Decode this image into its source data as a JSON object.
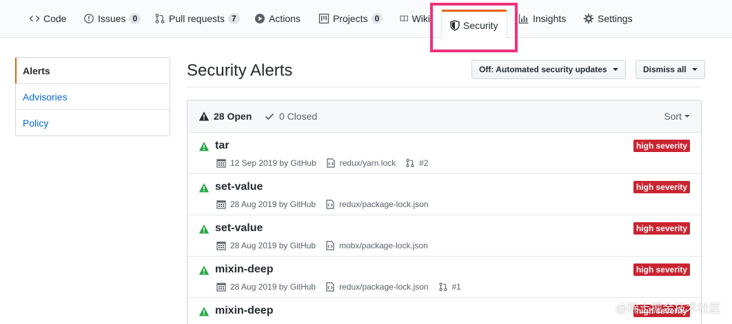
{
  "tabs": [
    {
      "label": "Code",
      "icon": "code-icon"
    },
    {
      "label": "Issues",
      "count": "0",
      "icon": "issue-icon"
    },
    {
      "label": "Pull requests",
      "count": "7",
      "icon": "pull-request-icon"
    },
    {
      "label": "Actions",
      "icon": "play-icon"
    },
    {
      "label": "Projects",
      "count": "0",
      "icon": "project-icon"
    },
    {
      "label": "Wiki",
      "icon": "book-icon"
    },
    {
      "label": "Security",
      "icon": "shield-icon",
      "selected": true
    },
    {
      "label": "Insights",
      "icon": "graph-icon"
    },
    {
      "label": "Settings",
      "icon": "gear-icon"
    }
  ],
  "menu": {
    "items": [
      {
        "label": "Alerts",
        "selected": true
      },
      {
        "label": "Advisories"
      },
      {
        "label": "Policy"
      }
    ]
  },
  "main": {
    "title": "Security Alerts",
    "auto_updates_button": "Off: Automated security updates",
    "dismiss_button": "Dismiss all"
  },
  "alerts_header": {
    "open": "28 Open",
    "closed": "0 Closed",
    "sort": "Sort"
  },
  "alerts": [
    {
      "name": "tar",
      "date": "12 Sep 2019 by GitHub",
      "file": "redux/yarn.lock",
      "pr": "#2",
      "severity": "high severity"
    },
    {
      "name": "set-value",
      "date": "28 Aug 2019 by GitHub",
      "file": "redux/package-lock.json",
      "severity": "high severity"
    },
    {
      "name": "set-value",
      "date": "28 Aug 2019 by GitHub",
      "file": "mobx/package-lock.json",
      "severity": "high severity"
    },
    {
      "name": "mixin-deep",
      "date": "28 Aug 2019 by GitHub",
      "file": "redux/package-lock.json",
      "pr": "#1",
      "severity": "high severity"
    },
    {
      "name": "mixin-deep",
      "severity": "high severity"
    }
  ],
  "watermark": "@稀土掘金技术社区",
  "colors": {
    "accent_tab": "#e36209",
    "highlight": "#f0307c",
    "severity": "#cb2431",
    "warning": "#28a745",
    "link": "#0366d6"
  }
}
